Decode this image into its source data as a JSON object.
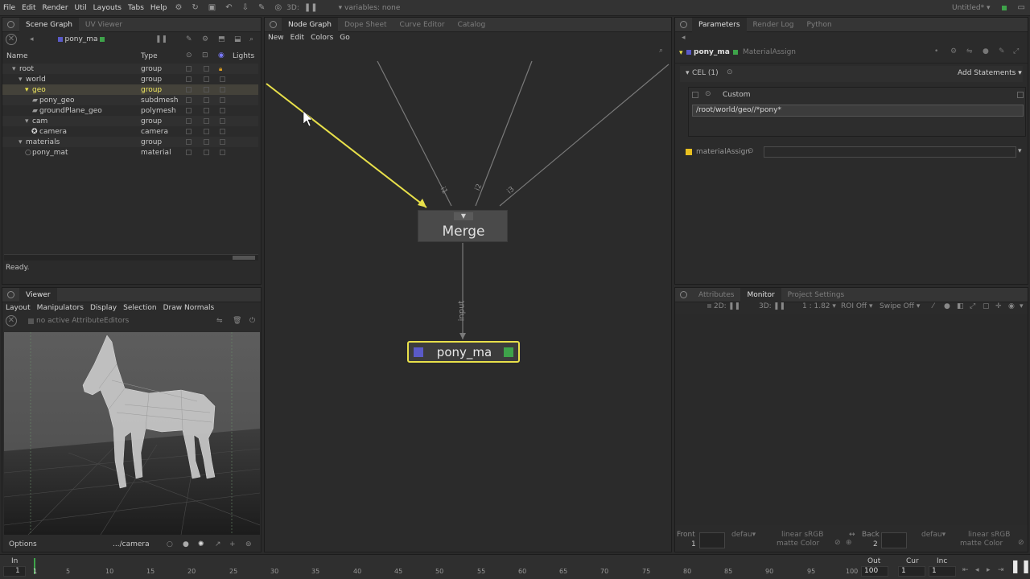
{
  "menubar": {
    "items": [
      "File",
      "Edit",
      "Render",
      "Util",
      "Layouts",
      "Tabs",
      "Help"
    ],
    "view3d": "3D:",
    "variables": "variables: none",
    "project": "Untitled*"
  },
  "scene_graph": {
    "tabs": [
      "Scene Graph",
      "UV Viewer"
    ],
    "node": "pony_ma",
    "columns": [
      "Name",
      "Type",
      "Lights"
    ],
    "rows": [
      {
        "name": "root",
        "type": "group"
      },
      {
        "name": "world",
        "type": "group"
      },
      {
        "name": "geo",
        "type": "group"
      },
      {
        "name": "pony_geo",
        "type": "subdmesh"
      },
      {
        "name": "groundPlane_geo",
        "type": "polymesh"
      },
      {
        "name": "cam",
        "type": "group"
      },
      {
        "name": "camera",
        "type": "camera"
      },
      {
        "name": "materials",
        "type": "group"
      },
      {
        "name": "pony_mat",
        "type": "material"
      }
    ],
    "status": "Ready."
  },
  "viewer": {
    "tab": "Viewer",
    "menu": [
      "Layout",
      "Manipulators",
      "Display",
      "Selection",
      "Draw Normals"
    ],
    "attr_editors": "no active AttributeEditors",
    "options": "Options",
    "camera": ".../camera"
  },
  "node_graph": {
    "tabs": [
      "Node Graph",
      "Dope Sheet",
      "Curve Editor",
      "Catalog"
    ],
    "menu": [
      "New",
      "Edit",
      "Colors",
      "Go"
    ],
    "merge_label": "Merge",
    "node_label": "pony_ma",
    "input_label": "input",
    "port_labels": [
      "i1",
      "i2",
      "i3"
    ]
  },
  "parameters": {
    "tabs": [
      "Parameters",
      "Render Log",
      "Python"
    ],
    "node_name": "pony_ma",
    "node_type": "MaterialAssign",
    "cel_label": "CEL (1)",
    "add_statements": "Add Statements",
    "custom_label": "Custom",
    "cel_value": "/root/world/geo//*pony*",
    "material_assign_label": "materialAssign",
    "material_assign_value": ""
  },
  "monitor": {
    "tabs": [
      "Attributes",
      "Monitor",
      "Project Settings"
    ],
    "toolbar": [
      "2D:",
      "3D:",
      "1 : 1.82",
      "ROI Off",
      "Swipe Off"
    ],
    "front_label": "Front",
    "front_num": "1",
    "back_label": "Back",
    "back_num": "2",
    "default_a": "defau",
    "default_b": "defau",
    "linear_a": "linear sRGB",
    "matte_a": "matte  Color",
    "linear_b": "linear sRGB",
    "matte_b": "matte  Color"
  },
  "timeline": {
    "in_label": "In",
    "in_value": "1",
    "numbers": [
      "1",
      "5",
      "10",
      "15",
      "20",
      "25",
      "30",
      "35",
      "40",
      "45",
      "50",
      "55",
      "60",
      "65",
      "70",
      "75",
      "80",
      "85",
      "90",
      "95",
      "100"
    ],
    "out_label": "Out",
    "out_value": "100",
    "cur_label": "Cur",
    "cur_value": "1",
    "inc_label": "Inc",
    "inc_value": "1"
  },
  "colors": {
    "accent_yellow": "#e8e04a",
    "node_purple": "#5a5ac8",
    "node_green": "#3ea34a"
  }
}
